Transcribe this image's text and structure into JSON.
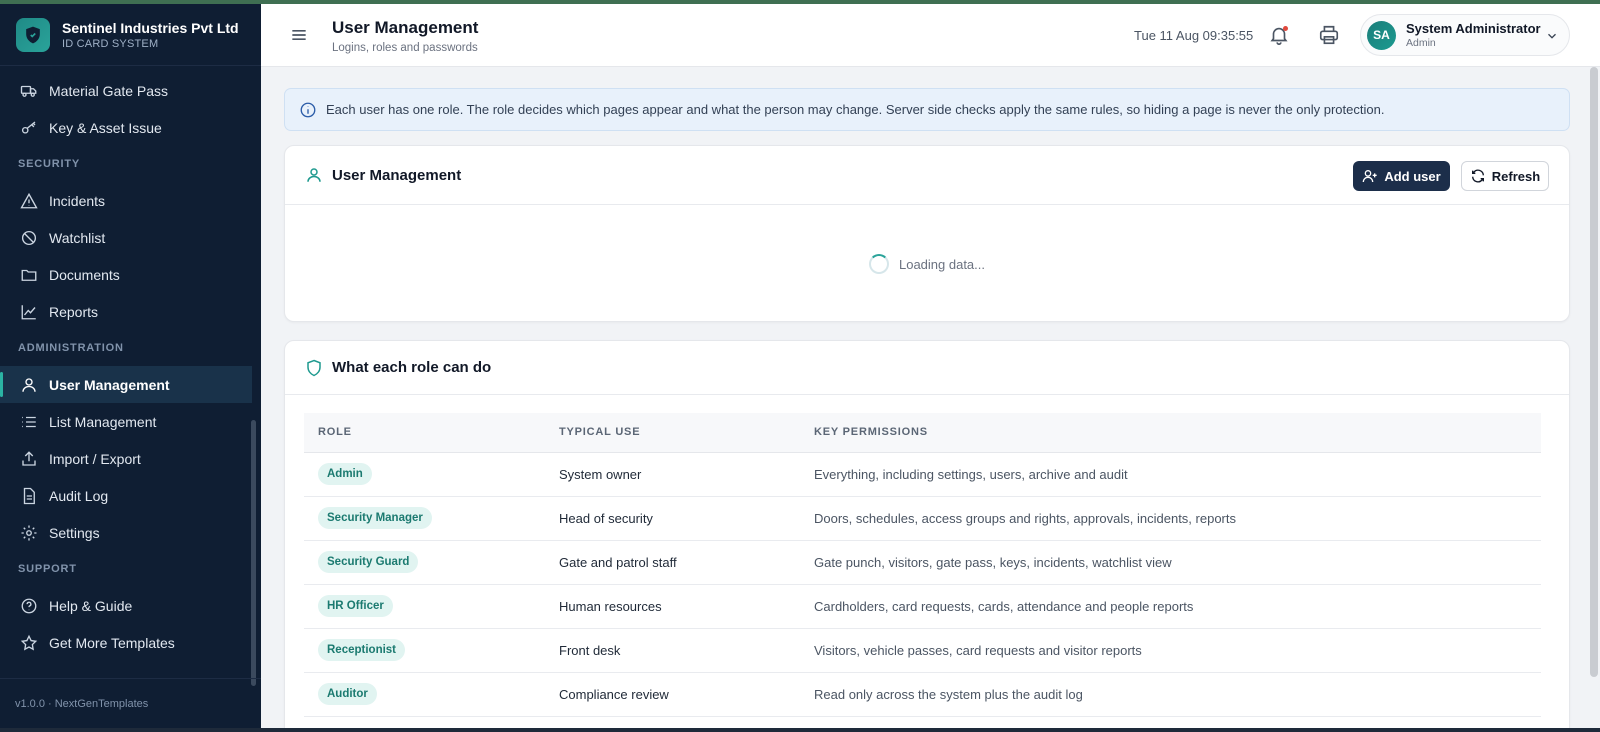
{
  "brand": {
    "name": "Sentinel Industries Pvt Ltd",
    "subtitle": "ID CARD SYSTEM"
  },
  "sidebar": {
    "top_items": [
      {
        "label": "Material Gate Pass",
        "icon": "truck-icon"
      },
      {
        "label": "Key & Asset Issue",
        "icon": "key-icon"
      }
    ],
    "sections": [
      {
        "title": "SECURITY",
        "items": [
          {
            "label": "Incidents",
            "icon": "warning-icon"
          },
          {
            "label": "Watchlist",
            "icon": "ban-icon"
          },
          {
            "label": "Documents",
            "icon": "folder-icon"
          },
          {
            "label": "Reports",
            "icon": "chart-line-icon"
          }
        ]
      },
      {
        "title": "ADMINISTRATION",
        "items": [
          {
            "label": "User Management",
            "icon": "user-icon",
            "active": true
          },
          {
            "label": "List Management",
            "icon": "list-icon"
          },
          {
            "label": "Import / Export",
            "icon": "upload-icon"
          },
          {
            "label": "Audit Log",
            "icon": "document-icon"
          },
          {
            "label": "Settings",
            "icon": "gear-icon"
          }
        ]
      },
      {
        "title": "SUPPORT",
        "items": [
          {
            "label": "Help & Guide",
            "icon": "help-circle-icon"
          },
          {
            "label": "Get More Templates",
            "icon": "star-icon"
          }
        ]
      }
    ],
    "version": "v1.0.0 · NextGenTemplates"
  },
  "header": {
    "title": "User Management",
    "subtitle": "Logins, roles and passwords",
    "datetime": "Tue 11 Aug 09:35:55",
    "user": {
      "initials": "SA",
      "name": "System Administrator",
      "role": "Admin"
    }
  },
  "banner": {
    "text": "Each user has one role. The role decides which pages appear and what the person may change. Server side checks apply the same rules, so hiding a page is never the only protection."
  },
  "users_card": {
    "title": "User Management",
    "add_label": "Add user",
    "refresh_label": "Refresh",
    "loading_text": "Loading data..."
  },
  "roles_card": {
    "title": "What each role can do",
    "columns": [
      "ROLE",
      "TYPICAL USE",
      "KEY PERMISSIONS"
    ],
    "rows": [
      {
        "role": "Admin",
        "use": "System owner",
        "permissions": "Everything, including settings, users, archive and audit"
      },
      {
        "role": "Security Manager",
        "use": "Head of security",
        "permissions": "Doors, schedules, access groups and rights, approvals, incidents, reports"
      },
      {
        "role": "Security Guard",
        "use": "Gate and patrol staff",
        "permissions": "Gate punch, visitors, gate pass, keys, incidents, watchlist view"
      },
      {
        "role": "HR Officer",
        "use": "Human resources",
        "permissions": "Cardholders, card requests, cards, attendance and people reports"
      },
      {
        "role": "Receptionist",
        "use": "Front desk",
        "permissions": "Visitors, vehicle passes, card requests and visitor reports"
      },
      {
        "role": "Auditor",
        "use": "Compliance review",
        "permissions": "Read only across the system plus the audit log"
      }
    ]
  },
  "colors": {
    "sidebar_bg": "#0f1e33",
    "accent": "#2aa39a",
    "primary_button": "#1c2e4a",
    "pill_bg": "#e1f4f1",
    "pill_text": "#1b7a70"
  }
}
